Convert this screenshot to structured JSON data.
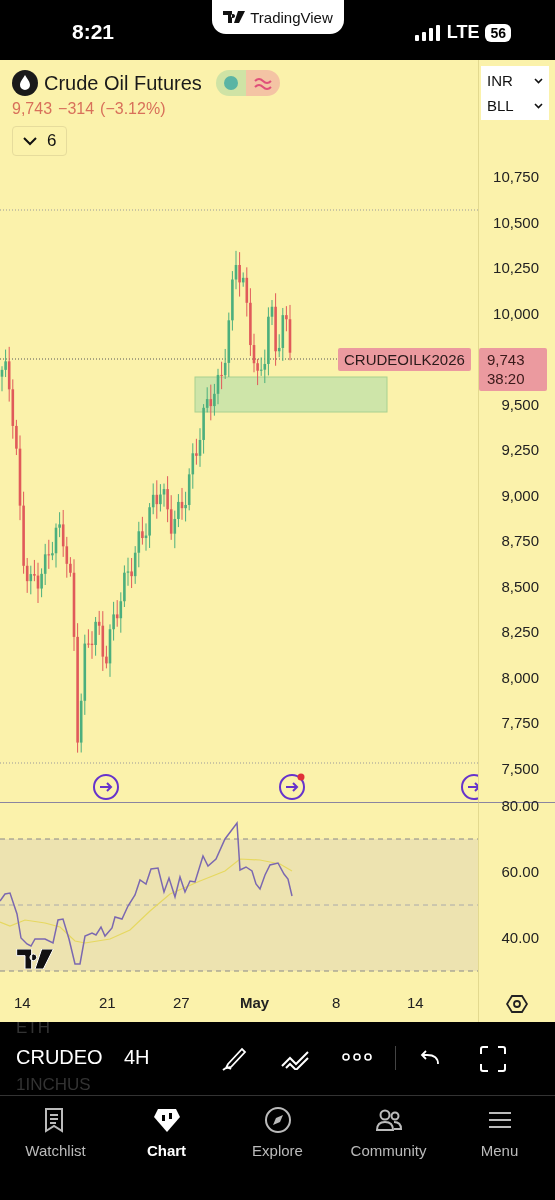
{
  "status_bar": {
    "time": "8:21",
    "app_pill": "TradingView",
    "network": "LTE",
    "battery": "56"
  },
  "header": {
    "title": "Crude Oil Futures",
    "price": "9,743",
    "change": "−314",
    "percent": "(−3.12%)",
    "indicators_button": "6",
    "selectors": [
      "INR",
      "BLL"
    ]
  },
  "chart": {
    "price_ticks": [
      "10,750",
      "10,500",
      "10,250",
      "10,000",
      "9,500",
      "9,250",
      "9,000",
      "8,750",
      "8,500",
      "8,250",
      "8,000",
      "7,750",
      "7,500"
    ],
    "price_label": {
      "symbol": "CRUDEOILK2026",
      "price": "9,743",
      "countdown": "38:20"
    }
  },
  "rsi": {
    "ticks": [
      "80.00",
      "60.00",
      "40.00"
    ]
  },
  "time_axis": [
    {
      "label": "14",
      "kind": "day"
    },
    {
      "label": "21",
      "kind": "day"
    },
    {
      "label": "27",
      "kind": "day"
    },
    {
      "label": "May",
      "kind": "month"
    },
    {
      "label": "8",
      "kind": "day"
    },
    {
      "label": "14",
      "kind": "day"
    }
  ],
  "toolbar": {
    "symbols": [
      "ETH",
      "CRUDEO",
      "1INCHUS"
    ],
    "interval": "4H"
  },
  "nav": [
    {
      "label": "Watchlist",
      "selected": false
    },
    {
      "label": "Chart",
      "selected": true
    },
    {
      "label": "Explore",
      "selected": false
    },
    {
      "label": "Community",
      "selected": false
    },
    {
      "label": "Menu",
      "selected": false
    }
  ]
}
